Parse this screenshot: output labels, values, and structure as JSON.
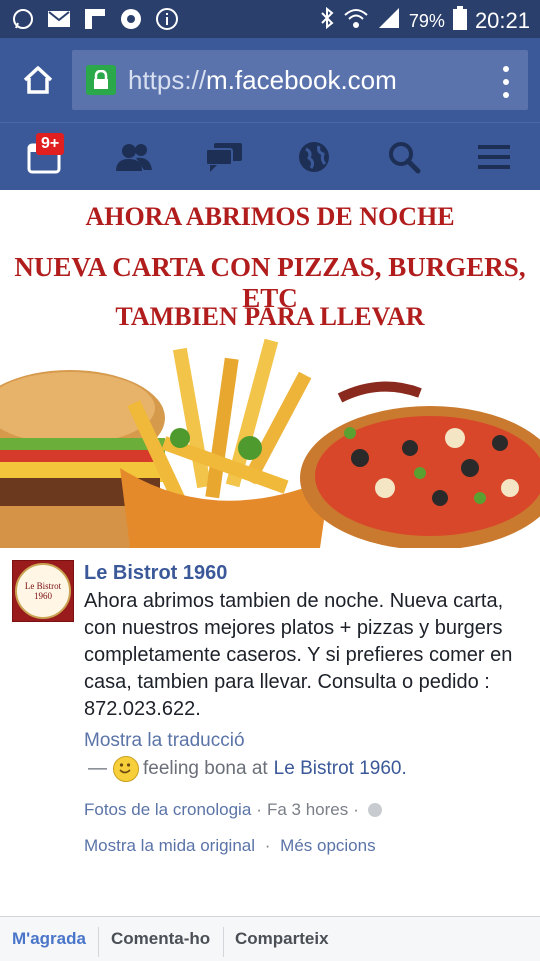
{
  "statusbar": {
    "icons_left": [
      "whatsapp-icon",
      "gmail-icon",
      "flipboard-icon",
      "chrome-icon",
      "info-icon"
    ],
    "icons_right": [
      "bluetooth-icon",
      "wifi-icon",
      "signal-icon",
      "battery-icon"
    ],
    "battery": "79%",
    "time": "20:21"
  },
  "browser": {
    "url_scheme": "https://",
    "url_host": "m.facebook.com"
  },
  "fbnav": {
    "notifications_badge": "9+",
    "items": [
      "notifications-icon",
      "friends-icon",
      "messages-icon",
      "globe-icon",
      "search-icon",
      "menu-icon"
    ]
  },
  "banner": {
    "line1": "AHORA ABRIMOS DE NOCHE",
    "line2": "NUEVA CARTA CON PIZZAS, BURGERS, ETC",
    "line3": "TAMBIEN PARA LLEVAR"
  },
  "post": {
    "avatar_text": "Le Bistrot 1960",
    "author": "Le Bistrot 1960",
    "text": "Ahora abrimos tambien de noche. Nueva carta, con nuestros mejores platos + pizzas y burgers completamente caseros. Y si prefieres comer en casa, tambien para llevar. Consulta o pedido : 872.023.622.",
    "translate": "Mostra la traducció",
    "feeling_prefix": "—",
    "feeling_text": "feeling bona at",
    "feeling_place": "Le Bistrot 1960",
    "feeling_suffix": ".",
    "album": "Fotos de la cronologia",
    "time": "Fa 3 hores",
    "sep": "·",
    "view_full": "Mostra la mida original",
    "more_options": "Més opcions"
  },
  "actions": {
    "like": "M'agrada",
    "comment": "Comenta-ho",
    "share": "Comparteix"
  },
  "colors": {
    "facebook_blue": "#3b5998",
    "statusbar": "#2a3f6c",
    "banner_text": "#b11c1c",
    "like_active": "#4a76c9"
  }
}
